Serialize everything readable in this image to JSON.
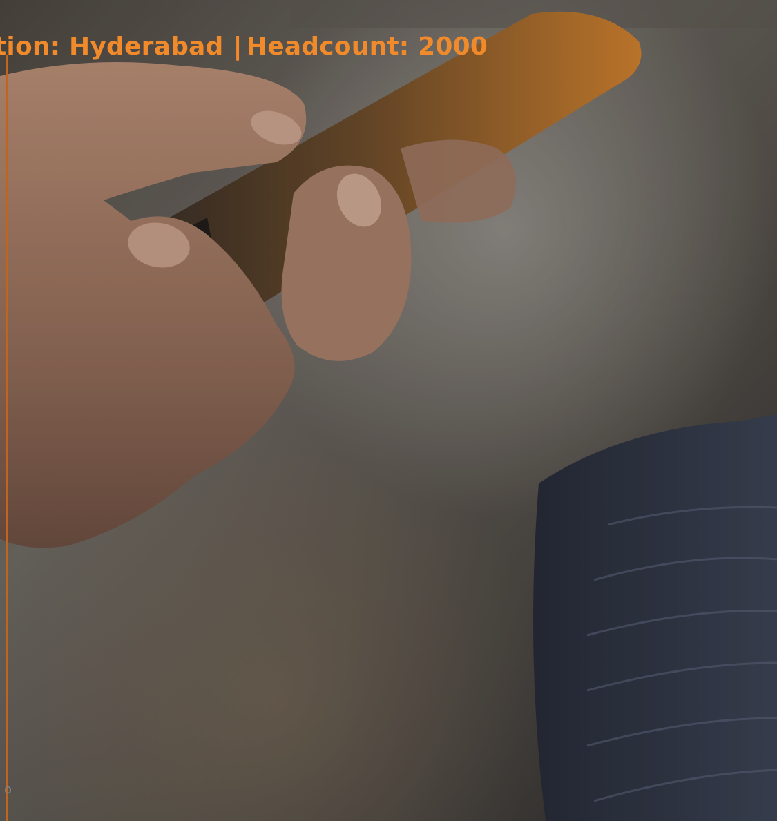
{
  "banner": {
    "location_text": "tion: Hyderabad",
    "separator": "|",
    "headcount_text": "Headcount: 2000",
    "footer_glyph": "o",
    "accent_color": "#f08a2a",
    "rule_color": "#c0641f"
  },
  "photo": {
    "subject": "hand holding smartphone",
    "icon": "photo-image"
  }
}
